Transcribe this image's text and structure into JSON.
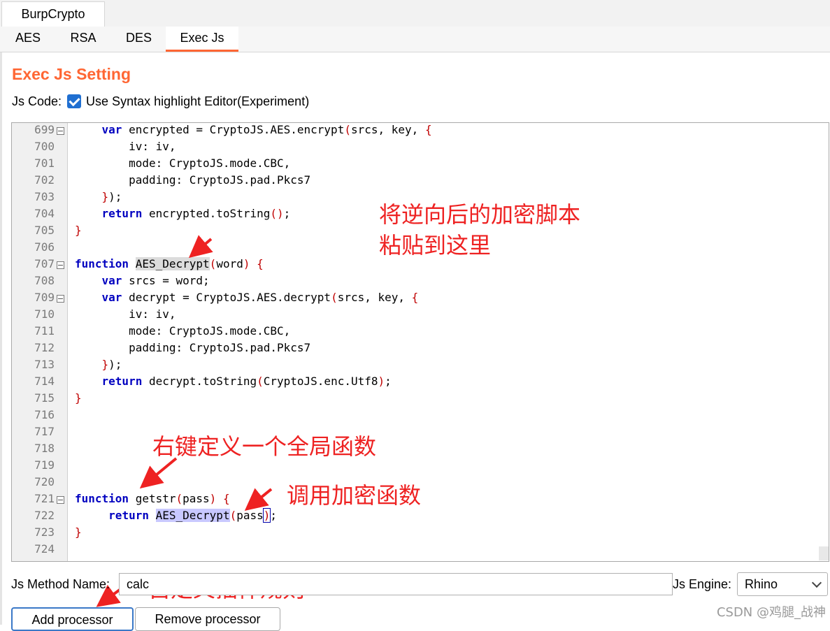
{
  "app_tab": "BurpCrypto",
  "sub_tabs": [
    "AES",
    "RSA",
    "DES",
    "Exec Js"
  ],
  "section_title": "Exec Js Setting",
  "js_code_label": "Js Code:",
  "syntax_checkbox_label": "Use Syntax highlight Editor(Experiment)",
  "editor": {
    "line_numbers": [
      "699",
      "700",
      "701",
      "702",
      "703",
      "704",
      "705",
      "706",
      "707",
      "708",
      "709",
      "710",
      "711",
      "712",
      "713",
      "714",
      "715",
      "716",
      "717",
      "718",
      "719",
      "720",
      "721",
      "722",
      "723",
      "724"
    ]
  },
  "annotations": {
    "paste_script_line1": "将逆向后的加密脚本",
    "paste_script_line2": "粘贴到这里",
    "define_global_function": "右键定义一个全局函数",
    "call_encrypt_function": "调用加密函数",
    "custom_plugin_rule": "自定义插件规则"
  },
  "method_name_label": "Js Method Name:",
  "method_name_value": "calc",
  "engine_label": "Js Engine:",
  "engine_value": "Rhino",
  "add_button": "Add processor",
  "remove_button": "Remove processor",
  "watermark": "CSDN @鸡腿_战神",
  "colors": {
    "accent": "#ff6633",
    "checkbox": "#1f6fd1",
    "annotation": "#ee2222",
    "keyword": "#0000c0"
  }
}
